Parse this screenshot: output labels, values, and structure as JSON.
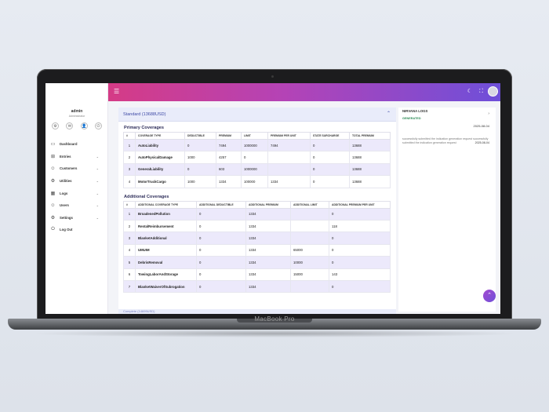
{
  "sidebar": {
    "user_name": "admin",
    "user_role": "Administrator",
    "quick_icons": [
      "⚙",
      "✉",
      "👤",
      "⏻"
    ],
    "items": [
      {
        "label": "Dashboard",
        "icon": "▭",
        "has_children": false
      },
      {
        "label": "Entries",
        "icon": "⊞",
        "has_children": true
      },
      {
        "label": "Customers",
        "icon": "☺",
        "has_children": true
      },
      {
        "label": "Utilities",
        "icon": "⚙",
        "has_children": true
      },
      {
        "label": "Logs",
        "icon": "▦",
        "has_children": true
      },
      {
        "label": "Users",
        "icon": "☺",
        "has_children": true
      },
      {
        "label": "Settings",
        "icon": "⚙",
        "has_children": true
      },
      {
        "label": "Log Out",
        "icon": "⏻",
        "has_children": false
      }
    ]
  },
  "topbar": {
    "menu_icon": "☰",
    "theme_icon": "☾",
    "fullscreen_icon": "⛶"
  },
  "standard": {
    "title": "Standard (13688USD)",
    "primary": {
      "heading": "Primary Coverages",
      "columns": [
        "#",
        "Coverage Type",
        "Deductible",
        "Premium",
        "Limit",
        "Premium Per Unit",
        "State Surcharge",
        "Total Premium"
      ],
      "rows": [
        [
          "1",
          "AutoLiability",
          "0",
          "7494",
          "1000000",
          "7494",
          "0",
          "13688"
        ],
        [
          "2",
          "AutoPhysicalDamage",
          "1000",
          "4257",
          "0",
          "",
          "0",
          "13688"
        ],
        [
          "3",
          "GeneralLiability",
          "0",
          "603",
          "1000000",
          "",
          "0",
          "13688"
        ],
        [
          "4",
          "MotorTruckCargo",
          "1000",
          "1334",
          "100000",
          "1334",
          "0",
          "13688"
        ]
      ]
    },
    "additional": {
      "heading": "Additional Coverages",
      "columns": [
        "#",
        "Additional Coverage Type",
        "Additional Deductible",
        "Additional Premium",
        "Additional Limit",
        "Additional Premium Per Unit"
      ],
      "rows": [
        [
          "1",
          "BroadenedPollution",
          "0",
          "1334",
          "",
          "0"
        ],
        [
          "2",
          "RentalReimbursement",
          "0",
          "1334",
          "",
          "118"
        ],
        [
          "3",
          "BlanketAdditional",
          "0",
          "1334",
          "",
          "0"
        ],
        [
          "4",
          "UMUIM",
          "0",
          "1334",
          "65000",
          "0"
        ],
        [
          "5",
          "DebrisRemoval",
          "0",
          "1334",
          "10000",
          "0"
        ],
        [
          "6",
          "TowingLaborAndStorage",
          "0",
          "1334",
          "15000",
          "143"
        ],
        [
          "7",
          "BlanketWaiverOfSubrogation",
          "0",
          "1334",
          "",
          "0"
        ]
      ]
    },
    "next_section": "Complete (14699USD)"
  },
  "logs": {
    "title": "NIRVANA LOGS",
    "status": "GENERATED",
    "date": "2025-08-04",
    "entry": "successfully submitted the indication generation request successfully submitted the indication generation request",
    "entry_date": "2025-08-04"
  },
  "device": {
    "brand": "MacBook Pro"
  },
  "colors": {
    "accent": "#6e4fd9",
    "row_shade": "#ece9fb",
    "status_green": "#2e8b57"
  }
}
